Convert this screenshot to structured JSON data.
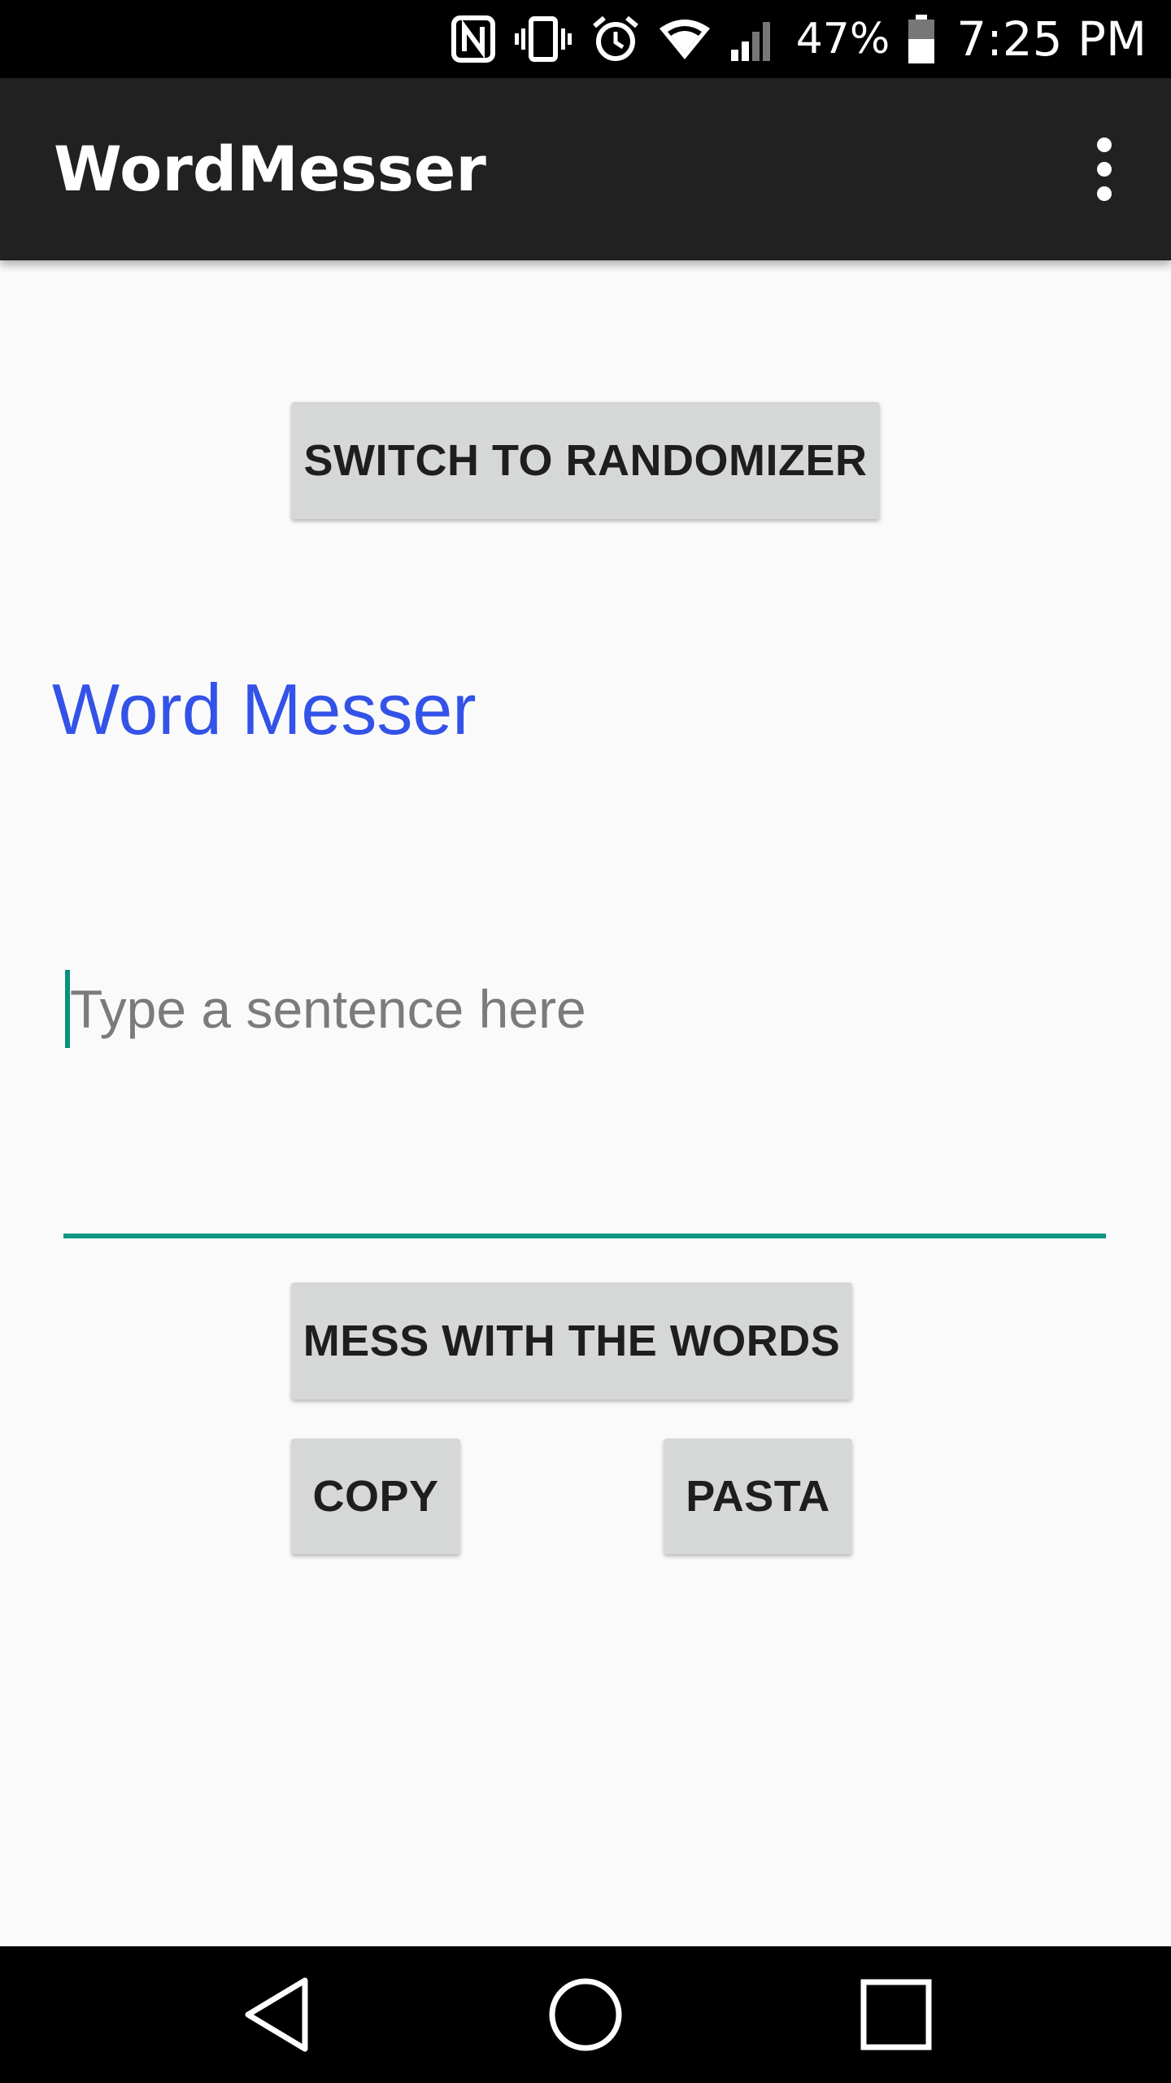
{
  "status_bar": {
    "battery_percent": "47%",
    "time": "7:25 PM",
    "icons": [
      "nfc-icon",
      "vibrate-icon",
      "alarm-icon",
      "wifi-icon",
      "signal-icon",
      "battery-icon"
    ]
  },
  "app_bar": {
    "title": "WordMesser",
    "menu_icon": "overflow-menu-icon"
  },
  "main": {
    "switch_button": "SWITCH TO RANDOMIZER",
    "heading": "Word Messer",
    "input": {
      "placeholder": "Type a sentence here",
      "value": ""
    },
    "mess_button": "MESS WITH THE WORDS",
    "copy_button": "COPY",
    "pasta_button": "PASTA"
  },
  "nav_bar": {
    "icons": [
      "back-icon",
      "home-icon",
      "recents-icon"
    ]
  },
  "colors": {
    "heading": "#3352e8",
    "accent": "#119683",
    "app_bar": "#212121",
    "button": "#d6d7d7"
  }
}
